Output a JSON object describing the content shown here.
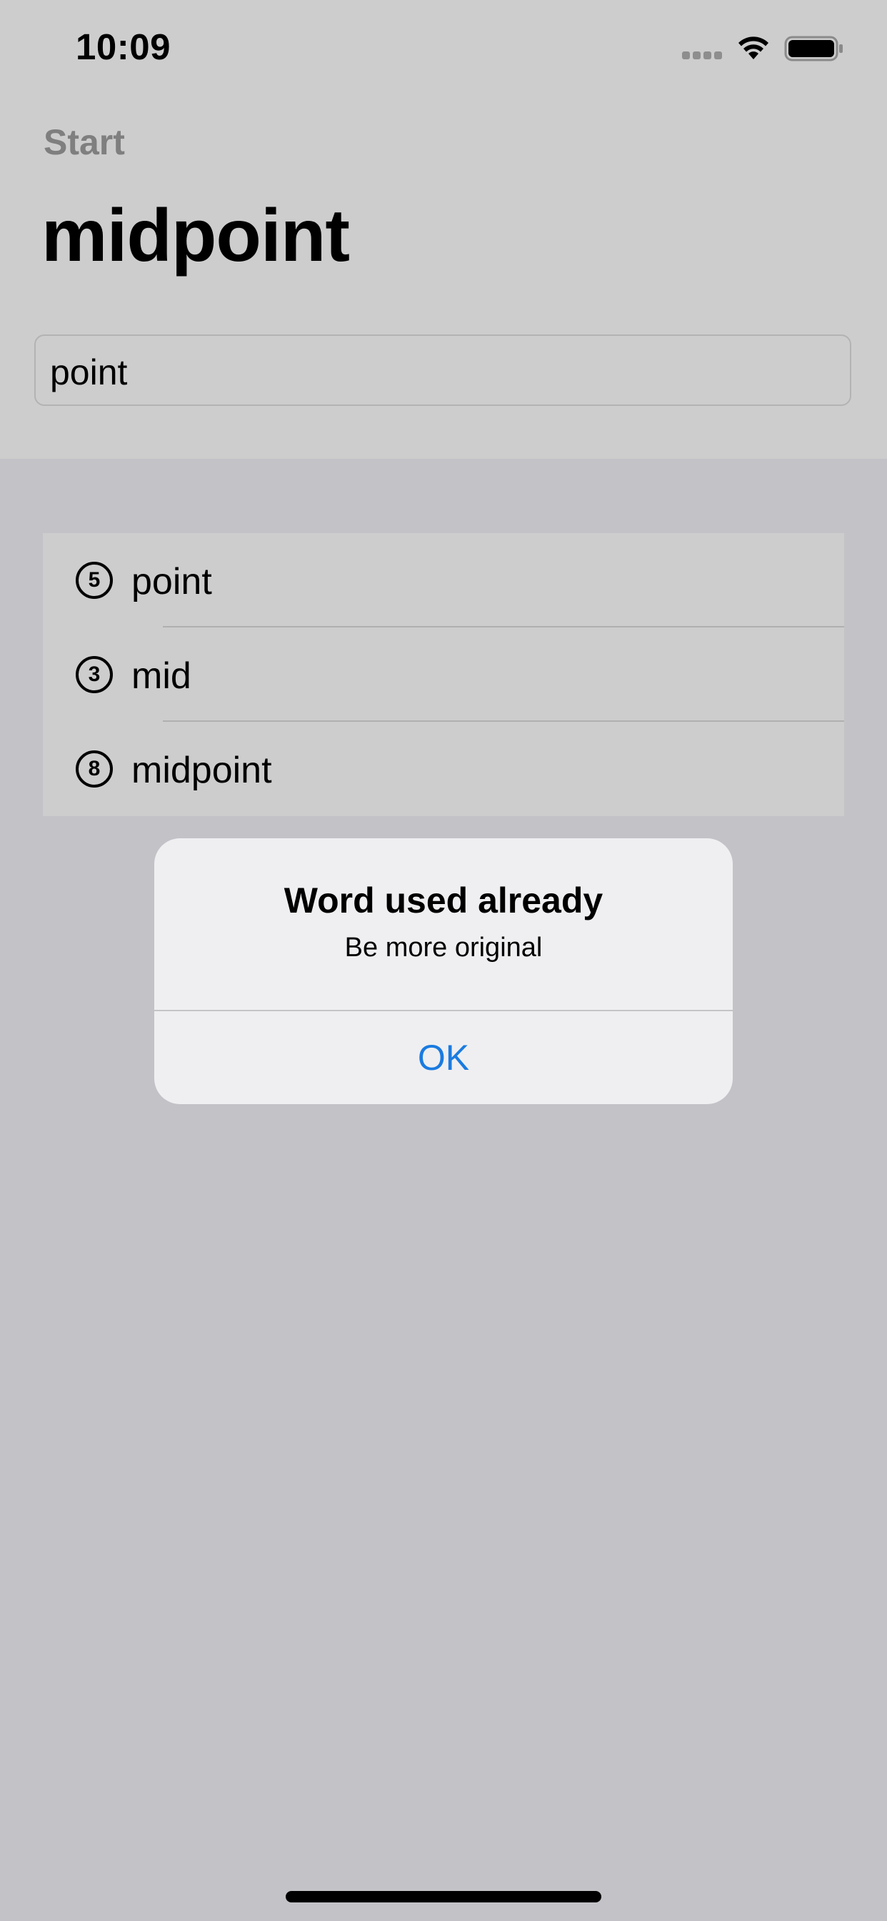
{
  "status_bar": {
    "time": "10:09",
    "icons": [
      "cellular-signal-icon",
      "wifi-icon",
      "battery-icon"
    ]
  },
  "nav": {
    "back_label": "Start",
    "title": "midpoint"
  },
  "word_field": {
    "value": "point"
  },
  "used_words": [
    {
      "count": "5",
      "word": "point"
    },
    {
      "count": "3",
      "word": "mid"
    },
    {
      "count": "8",
      "word": "midpoint"
    }
  ],
  "alert": {
    "title": "Word used already",
    "message": "Be more original",
    "ok_label": "OK"
  },
  "colors": {
    "accent": "#1a7be0",
    "dimmed_background": "#c3c2c7",
    "alert_background": "#efeff1"
  }
}
